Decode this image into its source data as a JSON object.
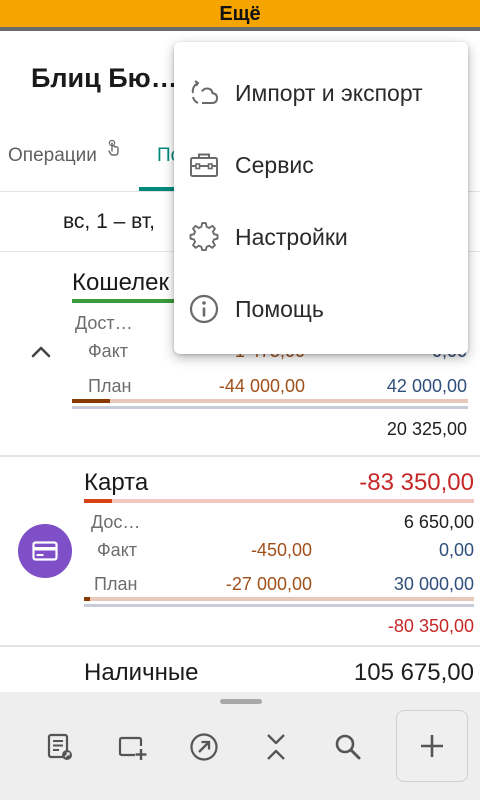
{
  "status_bar": {
    "title": "Ещё"
  },
  "app": {
    "title": "Блиц Бю…"
  },
  "tabs": [
    {
      "label": "Операции"
    },
    {
      "label": "По"
    },
    {
      "label": "н"
    }
  ],
  "date_range": "вс, 1 – вт,",
  "accounts": [
    {
      "name": "Кошелек",
      "available_label": "Дост…",
      "fact_label": "Факт",
      "fact_spent": "-1 475,00",
      "fact_income": "0,00",
      "plan_label": "План",
      "plan_spent": "-44 000,00",
      "plan_income": "42 000,00",
      "total": "20 325,00",
      "colors": {
        "name_bar": "#3a9a3a",
        "plan_bar": "#8a3a00",
        "plan_track": "#e8c8b8"
      }
    },
    {
      "name": "Карта",
      "amount": "-83 350,00",
      "available_label": "Дос…",
      "available": "6 650,00",
      "fact_label": "Факт",
      "fact_spent": "-450,00",
      "fact_income": "0,00",
      "plan_label": "План",
      "plan_spent": "-27 000,00",
      "plan_income": "30 000,00",
      "total": "-80 350,00",
      "icon": "credit-card-icon",
      "colors": {
        "amount": "#c62828",
        "name_bar": "#d84315",
        "icon_bg": "#7e4fc7"
      }
    },
    {
      "name": "Наличные",
      "amount": "105 675,00"
    }
  ],
  "colors": {
    "accent": "#00897b",
    "status_bar": "#f5a400",
    "negative": "#c62828",
    "spent_brown": "#a0501a",
    "income_blue": "#2f4f7a"
  },
  "menu": {
    "items": [
      {
        "label": "Импорт и экспорт",
        "icon": "cloud-sync-icon"
      },
      {
        "label": "Сервис",
        "icon": "toolbox-icon"
      },
      {
        "label": "Настройки",
        "icon": "gear-icon"
      },
      {
        "label": "Помощь",
        "icon": "info-icon"
      }
    ]
  },
  "bottom_bar": {
    "icons": [
      "report-icon",
      "add-window-icon",
      "arrow-circle-icon",
      "collapse-icon",
      "search-icon",
      "plus-icon"
    ]
  }
}
